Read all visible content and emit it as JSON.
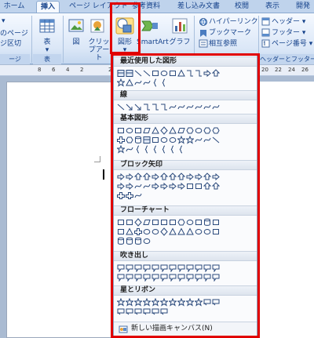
{
  "tabs": [
    "ホーム",
    "挿入",
    "ページ レイアウト",
    "参考資料",
    "差し込み文書",
    "校閲",
    "表示",
    "開発"
  ],
  "ribbon": {
    "pages_items": [
      "のページ",
      "ジ区切"
    ],
    "pages_group": "ージ",
    "table_label": "表",
    "table_group": "表",
    "picture_label": "図",
    "clipart_label": "クリップアート",
    "shapes_label": "図形",
    "smartart_label": "SmartArt",
    "chart_label": "グラフ",
    "links": [
      "ハイパーリンク",
      "ブックマーク",
      "相互参照"
    ],
    "header_footer": [
      "ヘッダー",
      "フッター",
      "ページ番号"
    ],
    "header_footer_group": "ヘッダーとフッター"
  },
  "ruler_numbers": [
    "8",
    "6",
    "4",
    "2",
    "2",
    "4",
    "6",
    "8",
    "10",
    "20",
    "22",
    "24",
    "26"
  ],
  "menu": {
    "sections": [
      "最近使用した図形",
      "線",
      "基本図形",
      "ブロック矢印",
      "フローチャート",
      "吹き出し",
      "星とリボン"
    ],
    "new_canvas": "新しい描画キャンバス(N)"
  },
  "colors": {
    "highlight": "#e10000",
    "ribbon_blue": "#15428b"
  }
}
